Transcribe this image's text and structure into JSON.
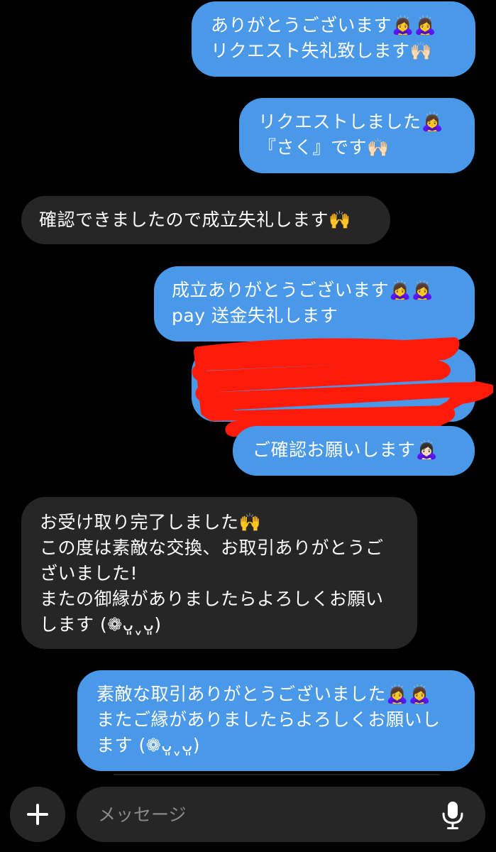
{
  "messages": [
    {
      "side": "sent",
      "lines": [
        "ありがとうございます🙇‍♀️🙇‍♀️",
        "リクエスト失礼致します🙌🏻"
      ]
    },
    {
      "side": "sent",
      "lines": [
        "リクエストしました🙇‍♀️",
        "『さく』です🙌🏻"
      ]
    },
    {
      "side": "received",
      "lines": [
        "確認できましたので成立失礼します🙌"
      ]
    },
    {
      "side": "sent",
      "lines": [
        "成立ありがとうございます🙇‍♀️🙇‍♀️",
        "pay 送金失礼します"
      ]
    },
    {
      "side": "sent",
      "redacted": true
    },
    {
      "side": "sent",
      "lines": [
        "ご確認お願いします🙇🏻‍♀️"
      ]
    },
    {
      "side": "received",
      "lines": [
        "お受け取り完了しました🙌",
        "この度は素敵な交換、お取引ありがとうご",
        "ざいました!",
        "またの御縁がありましたらよろしくお願い",
        "します (❁ᴗ͈ˬᴗ͈)"
      ]
    },
    {
      "side": "sent",
      "lines": [
        "素敵な取引ありがとうございました🙇‍♀️🙇‍♀️",
        "またご縁がありましたらよろしくお願いし",
        "ます (❁ᴗ͈ˬᴗ͈)"
      ]
    }
  ],
  "composer": {
    "placeholder": "メッセージ",
    "plus_icon": "plus-icon",
    "mic_icon": "microphone-icon"
  },
  "colors": {
    "sent_bubble": "#4A98E8",
    "received_bubble": "#262626",
    "redaction": "#FF1A0A",
    "background": "#000000"
  }
}
